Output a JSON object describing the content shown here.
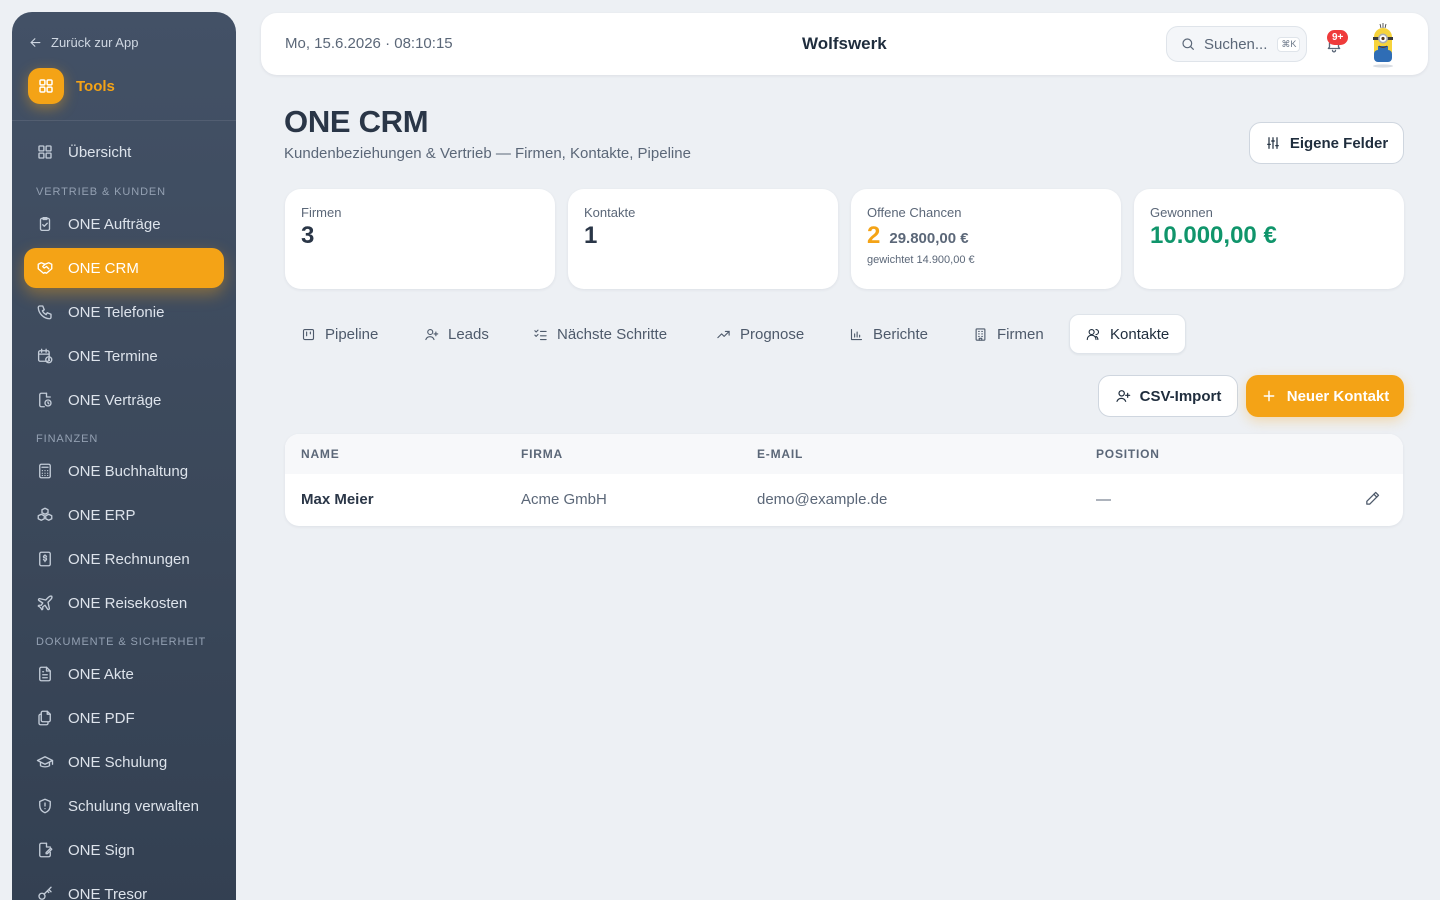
{
  "sidebar": {
    "back_label": "Zurück zur App",
    "tools_label": "Tools",
    "overview": "Übersicht",
    "sections": [
      "Vertrieb & Kunden",
      "Finanzen",
      "Dokumente & Sicherheit"
    ],
    "sales_items": [
      "ONE Aufträge",
      "ONE CRM",
      "ONE Telefonie",
      "ONE Termine",
      "ONE Verträge"
    ],
    "finance_items": [
      "ONE Buchhaltung",
      "ONE ERP",
      "ONE Rechnungen",
      "ONE Reisekosten"
    ],
    "docs_items": [
      "ONE Akte",
      "ONE PDF",
      "ONE Schulung",
      "Schulung verwalten",
      "ONE Sign",
      "ONE Tresor"
    ],
    "active_item": "ONE CRM"
  },
  "header": {
    "datetime": "Mo, 15.6.2026 · 08:10:15",
    "brand": "Wolfswerk",
    "search_placeholder": "Suchen...",
    "search_shortcut": "⌘K",
    "notification_count": "9+"
  },
  "page": {
    "title": "ONE CRM",
    "subtitle": "Kundenbeziehungen & Vertrieb — Firmen, Kontakte, Pipeline",
    "custom_fields_button": "Eigene Felder"
  },
  "stats": {
    "firms_label": "Firmen",
    "firms_value": "3",
    "contacts_label": "Kontakte",
    "contacts_value": "1",
    "open_label": "Offene Chancen",
    "open_count": "2",
    "open_amount": "29.800,00 €",
    "open_weighted": "gewichtet 14.900,00 €",
    "won_label": "Gewonnen",
    "won_value": "10.000,00 €"
  },
  "tabs": [
    "Pipeline",
    "Leads",
    "Nächste Schritte",
    "Prognose",
    "Berichte",
    "Firmen",
    "Kontakte"
  ],
  "active_tab": "Kontakte",
  "actions": {
    "csv_import": "CSV-Import",
    "new_contact": "Neuer Kontakt"
  },
  "table": {
    "columns": [
      "NAME",
      "FIRMA",
      "E-MAIL",
      "POSITION"
    ],
    "rows": [
      {
        "name": "Max Meier",
        "firma": "Acme GmbH",
        "email": "demo@example.de",
        "position": "—"
      }
    ]
  },
  "colors": {
    "accent": "#f4a316",
    "success": "#10956b",
    "sidebar_bg": "#3d4a5c",
    "badge_red": "#ef3b3b"
  }
}
